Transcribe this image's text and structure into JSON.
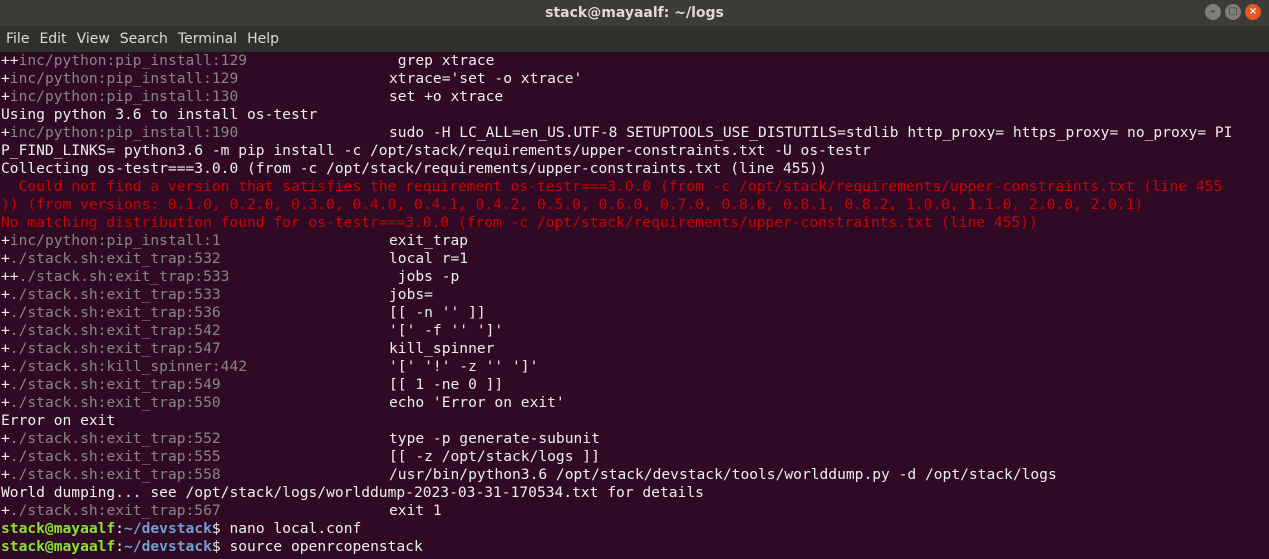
{
  "window": {
    "title": "stack@mayaalf: ~/logs",
    "buttons": [
      "–",
      "▢",
      "×"
    ]
  },
  "menu": [
    "File",
    "Edit",
    "View",
    "Search",
    "Terminal",
    "Help"
  ],
  "lines": [
    {
      "p": "++",
      "loc": "inc/python:pip_install:129",
      "cmd": " grep xtrace"
    },
    {
      "p": "+",
      "loc": "inc/python:pip_install:129",
      "cmd": "xtrace='set -o xtrace'"
    },
    {
      "p": "+",
      "loc": "inc/python:pip_install:130",
      "cmd": "set +o xtrace"
    },
    {
      "text": "Using python 3.6 to install os-testr"
    },
    {
      "p": "+",
      "loc": "inc/python:pip_install:190",
      "cmd": "sudo -H LC_ALL=en_US.UTF-8 SETUPTOOLS_USE_DISTUTILS=stdlib http_proxy= https_proxy= no_proxy= PI"
    },
    {
      "text": "P_FIND_LINKS= python3.6 -m pip install -c /opt/stack/requirements/upper-constraints.txt -U os-testr"
    },
    {
      "text": "Collecting os-testr===3.0.0 (from -c /opt/stack/requirements/upper-constraints.txt (line 455))"
    },
    {
      "err": "  Could not find a version that satisfies the requirement os-testr===3.0.0 (from -c /opt/stack/requirements/upper-constraints.txt (line 455"
    },
    {
      "err": ")) (from versions: 0.1.0, 0.2.0, 0.3.0, 0.4.0, 0.4.1, 0.4.2, 0.5.0, 0.6.0, 0.7.0, 0.8.0, 0.8.1, 0.8.2, 1.0.0, 1.1.0, 2.0.0, 2.0.1)"
    },
    {
      "err": "No matching distribution found for os-testr===3.0.0 (from -c /opt/stack/requirements/upper-constraints.txt (line 455))"
    },
    {
      "p": "+",
      "loc": "inc/python:pip_install:1",
      "cmd": "exit_trap"
    },
    {
      "p": "+",
      "loc": "./stack.sh:exit_trap:532",
      "cmd": "local r=1"
    },
    {
      "p": "++",
      "loc": "./stack.sh:exit_trap:533",
      "cmd": " jobs -p"
    },
    {
      "p": "+",
      "loc": "./stack.sh:exit_trap:533",
      "cmd": "jobs="
    },
    {
      "p": "+",
      "loc": "./stack.sh:exit_trap:536",
      "cmd": "[[ -n '' ]]"
    },
    {
      "p": "+",
      "loc": "./stack.sh:exit_trap:542",
      "cmd": "'[' -f '' ']'"
    },
    {
      "p": "+",
      "loc": "./stack.sh:exit_trap:547",
      "cmd": "kill_spinner"
    },
    {
      "p": "+",
      "loc": "./stack.sh:kill_spinner:442",
      "cmd": "'[' '!' -z '' ']'"
    },
    {
      "p": "+",
      "loc": "./stack.sh:exit_trap:549",
      "cmd": "[[ 1 -ne 0 ]]"
    },
    {
      "p": "+",
      "loc": "./stack.sh:exit_trap:550",
      "cmd": "echo 'Error on exit'"
    },
    {
      "text": "Error on exit"
    },
    {
      "p": "+",
      "loc": "./stack.sh:exit_trap:552",
      "cmd": "type -p generate-subunit"
    },
    {
      "p": "+",
      "loc": "./stack.sh:exit_trap:555",
      "cmd": "[[ -z /opt/stack/logs ]]"
    },
    {
      "p": "+",
      "loc": "./stack.sh:exit_trap:558",
      "cmd": "/usr/bin/python3.6 /opt/stack/devstack/tools/worlddump.py -d /opt/stack/logs"
    },
    {
      "text": "World dumping... see /opt/stack/logs/worlddump-2023-03-31-170534.txt for details"
    },
    {
      "p": "+",
      "loc": "./stack.sh:exit_trap:567",
      "cmd": "exit 1"
    },
    {
      "prompt": {
        "user": "stack@mayaalf",
        "sep": ":",
        "dir": "~/devstack",
        "sym": "$ ",
        "cmd": "nano local.conf"
      }
    },
    {
      "prompt": {
        "user": "stack@mayaalf",
        "sep": ":",
        "dir": "~/devstack",
        "sym": "$ ",
        "cmd": "source openrcopenstack"
      }
    }
  ],
  "colors": {
    "background": "#300a24",
    "text": "#eeeeec",
    "trace_location": "#8a8584",
    "error": "#cc0000",
    "prompt_user": "#8ae234",
    "prompt_dir": "#729fcf",
    "close_button": "#e95420"
  }
}
